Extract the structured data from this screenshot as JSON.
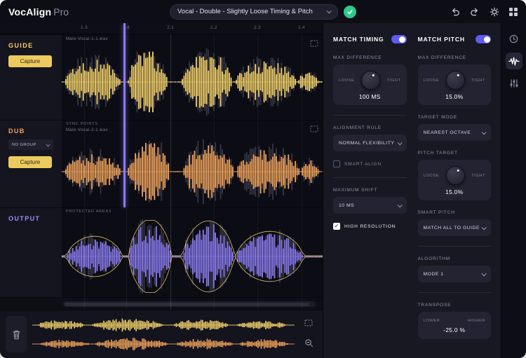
{
  "titlebar": {
    "app_name": "VocAlign",
    "app_suffix": "Pro",
    "preset": "Vocal - Double - Slightly Loose Timing & Pitch"
  },
  "ruler": {
    "ticks": [
      {
        "label": "1.3",
        "pos": 0.086
      },
      {
        "label": "1.4",
        "pos": 0.247
      },
      {
        "label": "2.1",
        "pos": 0.417
      },
      {
        "label": "2.2",
        "pos": 0.583
      },
      {
        "label": "2.3",
        "pos": 0.75
      },
      {
        "label": "2.4",
        "pos": 0.919
      }
    ]
  },
  "tracks": {
    "guide": {
      "name": "GUIDE",
      "file": "Male-Vocal-1-1.wav",
      "capture_label": "Capture"
    },
    "dub": {
      "name": "DUB",
      "file": "Male-Vocal-2-1.wav",
      "capture_label": "Capture",
      "group_value": "NO GROUP",
      "sync_label": "SYNC POINTS"
    },
    "output": {
      "name": "OUTPUT",
      "protected_label": "PROTECTED AREAS"
    }
  },
  "timing": {
    "title": "MATCH TIMING",
    "max_difference_label": "MAX DIFFERENCE",
    "knob": {
      "left": "LOOSE",
      "right": "TIGHT",
      "value": "100 MS"
    },
    "alignment_rule_label": "ALIGNMENT RULE",
    "alignment_rule_value": "NORMAL FLEXIBILITY",
    "smart_align_label": "SMART ALIGN",
    "maximum_shift_label": "MAXIMUM SHIFT",
    "maximum_shift_value": "10 MS",
    "high_resolution_label": "HIGH RESOLUTION"
  },
  "pitch": {
    "title": "MATCH PITCH",
    "max_difference_label": "MAX DIFFERENCE",
    "max_diff_knob": {
      "left": "LOOSE",
      "right": "TIGHT",
      "value": "15.0%"
    },
    "target_mode_label": "TARGET MODE",
    "target_mode_value": "NEAREST OCTAVE",
    "pitch_target_label": "PITCH TARGET",
    "pitch_target_knob": {
      "left": "LOOSE",
      "right": "TIGHT",
      "value": "15.0%"
    },
    "smart_pitch_label": "SMART PITCH",
    "smart_pitch_value": "MATCH ALL TO GUIDE",
    "algorithm_label": "ALGORITHM",
    "algorithm_value": "MODE 1",
    "transpose_label": "TRANSPOSE",
    "transpose": {
      "left": "LOWER",
      "right": "HIGHER",
      "value": "-25.0 %"
    }
  },
  "toggles": {
    "match_timing": true,
    "match_pitch": true
  },
  "checkboxes": {
    "smart_align": false,
    "high_resolution": true
  },
  "colors": {
    "guide": "#f6d46a",
    "dub": "#f2a45a",
    "output": "#8b7cf2",
    "ghost": "#3a3a4a",
    "accent": "#5f5cf0",
    "green": "#2fc98c"
  },
  "waveforms": {
    "guide": {
      "color": "guide",
      "ghost": true,
      "seed": 1,
      "n": 150,
      "bursts": [
        {
          "f": 0.012,
          "t": 0.225,
          "a": 0.68
        },
        {
          "f": 0.256,
          "t": 0.405,
          "a": 0.95
        },
        {
          "f": 0.462,
          "t": 0.655,
          "a": 0.9
        },
        {
          "f": 0.668,
          "t": 0.9,
          "a": 0.62
        },
        {
          "f": 0.905,
          "t": 0.985,
          "a": 0.3
        }
      ]
    },
    "dub": {
      "color": "dub",
      "ghost": true,
      "seed": 2,
      "n": 150,
      "bursts": [
        {
          "f": 0.01,
          "t": 0.23,
          "a": 0.55
        },
        {
          "f": 0.255,
          "t": 0.415,
          "a": 0.92
        },
        {
          "f": 0.465,
          "t": 0.66,
          "a": 0.85
        },
        {
          "f": 0.67,
          "t": 0.915,
          "a": 0.72
        },
        {
          "f": 0.92,
          "t": 0.99,
          "a": 0.35
        }
      ]
    },
    "output": {
      "color": "output",
      "ghost": true,
      "outline": true,
      "seed": 3,
      "n": 150,
      "bursts": [
        {
          "f": 0.02,
          "t": 0.23,
          "a": 0.5
        },
        {
          "f": 0.258,
          "t": 0.42,
          "a": 0.92
        },
        {
          "f": 0.465,
          "t": 0.66,
          "a": 0.88
        },
        {
          "f": 0.67,
          "t": 0.925,
          "a": 0.62
        }
      ]
    },
    "mini_guide": {
      "color": "guide",
      "ghost": false,
      "seed": 7,
      "n": 170,
      "bursts": [
        {
          "f": 0.02,
          "t": 0.2,
          "a": 0.7
        },
        {
          "f": 0.23,
          "t": 0.5,
          "a": 0.9
        },
        {
          "f": 0.54,
          "t": 0.75,
          "a": 0.8
        },
        {
          "f": 0.78,
          "t": 0.97,
          "a": 0.6
        }
      ]
    },
    "mini_dub": {
      "color": "dub",
      "ghost": false,
      "seed": 9,
      "n": 170,
      "bursts": [
        {
          "f": 0.03,
          "t": 0.22,
          "a": 0.6
        },
        {
          "f": 0.24,
          "t": 0.52,
          "a": 0.85
        },
        {
          "f": 0.55,
          "t": 0.77,
          "a": 0.75
        },
        {
          "f": 0.79,
          "t": 0.98,
          "a": 0.65
        }
      ]
    }
  }
}
